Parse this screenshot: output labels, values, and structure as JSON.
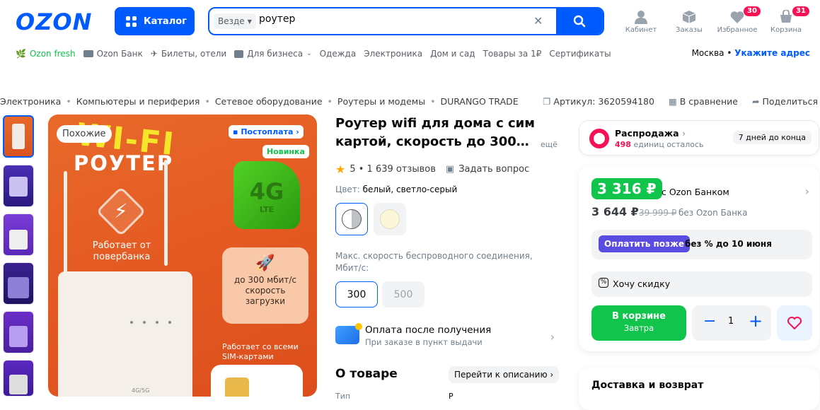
{
  "header": {
    "logo": "OZON",
    "catalog_label": "Каталог",
    "search": {
      "scope": "Везде",
      "query": "роутер"
    },
    "icons": [
      {
        "label": "Кабинет",
        "icon": "person-icon",
        "badge": ""
      },
      {
        "label": "Заказы",
        "icon": "box-icon",
        "badge": ""
      },
      {
        "label": "Избранное",
        "icon": "heart-icon",
        "badge": "30"
      },
      {
        "label": "Корзина",
        "icon": "cart-icon",
        "badge": "31"
      }
    ]
  },
  "nav": {
    "items": [
      "Ozon fresh",
      "Ozon Банк",
      "Билеты, отели",
      "Для бизнеса",
      "Одежда",
      "Электроника",
      "Дом и сад",
      "Товары за 1₽",
      "Сертификаты"
    ],
    "city": "Москва",
    "address_link": "Укажите адрес"
  },
  "breadcrumb": [
    "Электроника",
    "Компьютеры и периферия",
    "Сетевое оборудование",
    "Роутеры и модемы",
    "DURANGO TRADE"
  ],
  "product_meta": {
    "article": "Артикул: 3620594180",
    "compare": "В сравнение",
    "share": "Поделиться"
  },
  "image": {
    "similar": "Похожие",
    "postpay": "Постоплата",
    "new_badge": "Новинка",
    "headline_1": "WI-FI",
    "headline_2": "РОУТЕР",
    "powerbank": "Работает от повербанка",
    "lte_1": "4G",
    "lte_2": "LTE",
    "speed_text": "до 300 мбит/с скорость загрузки",
    "sim_text": "Работает со всеми SIM-картами",
    "device_label": "4G/5G"
  },
  "product": {
    "title": "Роутер wifi для дома с сим картой, скорость до 300…",
    "more": "ещё",
    "rating": "5 • 1 639 отзывов",
    "ask": "Задать вопрос",
    "color_label": "Цвет:",
    "color_value": "белый, светло-серый",
    "speed_label": "Макс. скорость беспроводного соединения, Мбит/с:",
    "speeds": [
      "300",
      "500"
    ],
    "pay_title": "Оплата после получения",
    "pay_sub": "При заказе в пункт выдачи",
    "about": "О товаре",
    "goto_desc": "Перейти к описанию",
    "table_row_key": "Тип",
    "table_row_val": "Р"
  },
  "sale": {
    "title": "Распродажа",
    "remaining": "498",
    "remaining_suffix": "единиц осталось",
    "days": "7 дней до конца"
  },
  "price": {
    "ozon_price": "3 316 ₽",
    "ozon_caption": "с Ozon Банком",
    "regular_price": "3 644 ₽",
    "old_price": "39 999 ₽",
    "regular_caption": "без Ozon Банка",
    "paylater_btn": "Оплатить позже",
    "paylater_text": "без % до 10 июня",
    "discount": "Хочу скидку",
    "cart_btn": "В корзине",
    "cart_sub": "Завтра",
    "qty": "1"
  },
  "delivery": {
    "title": "Доставка и возврат"
  },
  "colors": {
    "brand": "#005bff",
    "green": "#10c44c",
    "pink": "#f91155",
    "purple": "#5a4ce0"
  }
}
